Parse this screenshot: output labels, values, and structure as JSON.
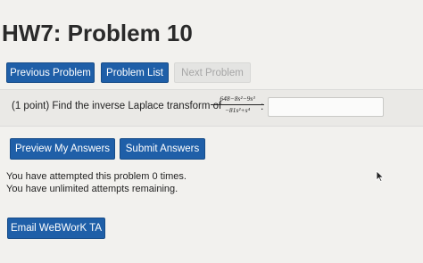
{
  "page": {
    "title": "HW7: Problem 10"
  },
  "nav": {
    "previous_label": "Previous Problem",
    "list_label": "Problem List",
    "next_label": "Next Problem"
  },
  "problem": {
    "prefix": "(1 point) Find the inverse Laplace transform of",
    "numerator": "648−8s²−9s³",
    "denominator": "−81s²+s⁴",
    "suffix": ":",
    "answer_value": ""
  },
  "actions": {
    "preview_label": "Preview My Answers",
    "submit_label": "Submit Answers"
  },
  "status": {
    "attempted": "You have attempted this problem 0 times.",
    "remaining": "You have unlimited attempts remaining."
  },
  "footer": {
    "email_label": "Email WeBWorK TA"
  },
  "colors": {
    "button_blue": "#1f5fa8",
    "background": "#f2f1ee"
  },
  "icons": {
    "cursor": "mouse-pointer-icon"
  }
}
